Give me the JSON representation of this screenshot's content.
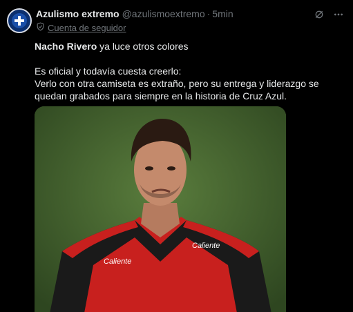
{
  "account": {
    "name": "Azulismo extremo",
    "handle": "@azulismoextremo",
    "separator": "·",
    "time": "5min",
    "follow_label": "Cuenta de seguidor"
  },
  "post": {
    "lead_bold": "Nacho Rivero",
    "lead_rest": " ya luce otros colores",
    "line2": "Es oficial y todavía cuesta creerlo:",
    "line3": "Verlo con otra camiseta es extraño, pero su entrega y liderazgo se quedan grabados para siempre en la historia de Cruz Azul."
  },
  "media": {
    "jersey_sponsor_left": "Caliente",
    "jersey_sponsor_right": "Caliente"
  },
  "icons": [
    "grok-icon",
    "more-icon",
    "shield-icon"
  ],
  "colors": {
    "background": "#000000",
    "text": "#e7e9ea",
    "muted": "#71767b"
  }
}
